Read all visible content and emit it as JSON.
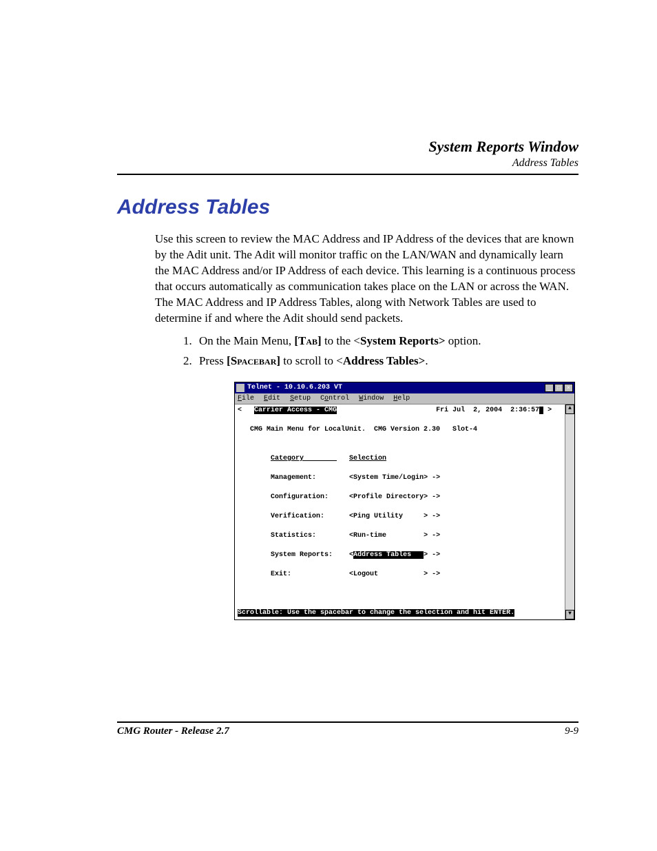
{
  "header": {
    "title": "System Reports Window",
    "subtitle": "Address Tables"
  },
  "section_heading": "Address Tables",
  "paragraph": "Use this screen to review the MAC Address and IP Address of the devices that are known by the Adit unit. The Adit will monitor traffic on the LAN/WAN and dynamically learn the MAC Address and/or IP Address of each device. This learning is a continuous process that occurs automatically as communication takes place on the LAN or across the WAN. The MAC Address and IP Address Tables, along with Network Tables are used to determine if and where the Adit should send packets.",
  "steps": {
    "s1_pre": "On the Main Menu, ",
    "s1_key": "[Tab]",
    "s1_mid": " to the <",
    "s1_opt": "System Reports>",
    "s1_post": " option.",
    "s2_pre": "Press ",
    "s2_key": "[Spacebar]",
    "s2_mid": " to scroll to <",
    "s2_opt": "Address Tables>",
    "s2_post": "."
  },
  "telnet": {
    "title": "Telnet - 10.10.6.203 VT",
    "menus": {
      "file": "File",
      "edit": "Edit",
      "setup": "Setup",
      "control": "Control",
      "window": "Window",
      "help": "Help"
    },
    "win_btns": {
      "min": "_",
      "max": "□",
      "close": "×"
    },
    "top_left_hl": "Carrier Access - CMG",
    "top_angle_l": "<",
    "datetime": "Fri Jul  2, 2004  2:36:57",
    "top_angle_r": " >",
    "subhead": "   CMG Main Menu for LocalUnit.  CMG Version 2.30   Slot-4",
    "col1": "Category        ",
    "col2": "Selection",
    "rows": [
      {
        "cat": "Management:",
        "sel_pre": "<System Time/Login> ->",
        "hl": ""
      },
      {
        "cat": "Configuration:",
        "sel_pre": "<Profile Directory> ->",
        "hl": ""
      },
      {
        "cat": "Verification:",
        "sel_pre": "<Ping Utility     > ->",
        "hl": ""
      },
      {
        "cat": "Statistics:",
        "sel_pre": "<Run-time         > ->",
        "hl": ""
      },
      {
        "cat": "System Reports:",
        "sel_pre": "<",
        "hl": "Address Tables   ",
        "sel_post": "> ->"
      },
      {
        "cat": "Exit:",
        "sel_pre": "<Logout           > ->",
        "hl": ""
      }
    ],
    "status": "Scrollable: Use the spacebar to change the selection and hit ENTER.",
    "scroll": {
      "up": "▲",
      "down": "▼"
    }
  },
  "footer": {
    "left": "CMG Router - Release 2.7",
    "right": "9-9"
  }
}
